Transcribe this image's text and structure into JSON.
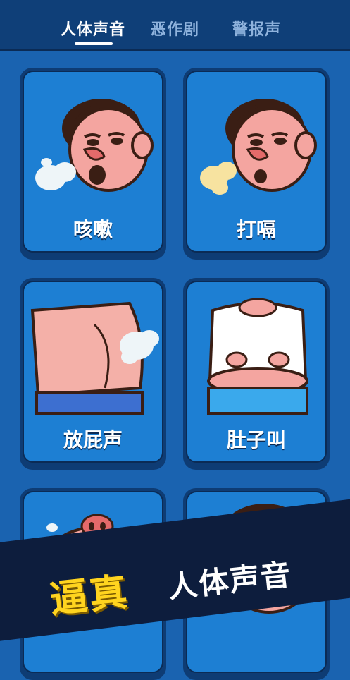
{
  "tabs": [
    {
      "label": "人体声音",
      "active": true
    },
    {
      "label": "恶作剧",
      "active": false
    },
    {
      "label": "警报声",
      "active": false
    }
  ],
  "cards": [
    {
      "label": "咳嗽",
      "icon": "cough-face-icon"
    },
    {
      "label": "打嗝",
      "icon": "burp-face-icon"
    },
    {
      "label": "放屁声",
      "icon": "fart-butt-icon"
    },
    {
      "label": "肚子叫",
      "icon": "belly-icon"
    },
    {
      "label": "",
      "icon": "crying-pig-face-icon"
    },
    {
      "label": "",
      "icon": "hair-face-icon"
    }
  ],
  "banner": {
    "highlight": "逼真",
    "text": "人体声音"
  },
  "colors": {
    "header": "#0f3f78",
    "background": "#1a63b0",
    "card": "#1d7fd3",
    "banner_yellow": "#ffd41f"
  }
}
